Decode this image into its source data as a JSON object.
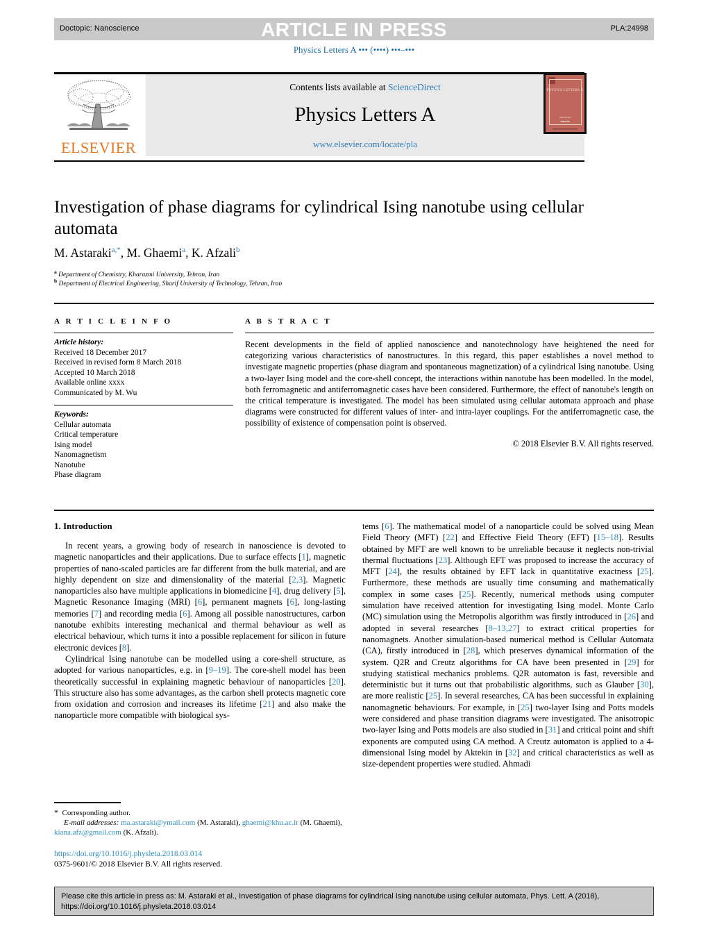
{
  "header": {
    "doctopic": "Doctopic: Nanoscience",
    "status_banner": "ARTICLE IN PRESS",
    "article_code": "PLA:24998",
    "running_head": "Physics Letters A ••• (••••) •••–•••"
  },
  "masthead": {
    "publisher_name": "ELSEVIER",
    "contents_prefix": "Contents lists available at ",
    "contents_link": "ScienceDirect",
    "journal_title": "Physics Letters A",
    "journal_url": "www.elsevier.com/locate/pla",
    "cover": {
      "title": "PHYSICS LETTERS A",
      "footer_small": "Editor-in-Chief",
      "footer_bold": "Editorial"
    }
  },
  "article": {
    "title": "Investigation of phase diagrams for cylindrical Ising nanotube using cellular automata",
    "authors_html": "M. Astaraki<sup>a,*</sup>, M. Ghaemi<sup>a</sup>, K. Afzali<sup>b</sup>",
    "authors_plain": "M. Astaraki a,*, M. Ghaemi a, K. Afzali b",
    "affiliations": [
      {
        "marker": "a",
        "text": "Department of Chemistry, Kharazmi University, Tehran, Iran"
      },
      {
        "marker": "b",
        "text": "Department of Electrical Engineering, Sharif University of Technology, Tehran, Iran"
      }
    ]
  },
  "article_info": {
    "heading": "A R T I C L E   I N F O",
    "history_label": "Article history:",
    "history": [
      "Received 18 December 2017",
      "Received in revised form 8 March 2018",
      "Accepted 10 March 2018",
      "Available online xxxx",
      "Communicated by M. Wu"
    ],
    "keywords_label": "Keywords:",
    "keywords": [
      "Cellular automata",
      "Critical temperature",
      "Ising model",
      "Nanomagnetism",
      "Nanotube",
      "Phase diagram"
    ]
  },
  "abstract": {
    "heading": "A B S T R A C T",
    "text": "Recent developments in the field of applied nanoscience and nanotechnology have heightened the need for categorizing various characteristics of nanostructures. In this regard, this paper establishes a novel method to investigate magnetic properties (phase diagram and spontaneous magnetization) of a cylindrical Ising nanotube. Using a two-layer Ising model and the core-shell concept, the interactions within nanotube has been modelled. In the model, both ferromagnetic and antiferromagnetic cases have been considered. Furthermore, the effect of nanotube's length on the critical temperature is investigated. The model has been simulated using cellular automata approach and phase diagrams were constructed for different values of inter- and intra-layer couplings. For the antiferromagnetic case, the possibility of existence of compensation point is observed.",
    "copyright": "© 2018 Elsevier B.V. All rights reserved."
  },
  "body": {
    "section_heading": "1. Introduction",
    "left_paragraph_1_html": "In recent years, a growing body of research in nanoscience is devoted to magnetic nanoparticles and their applications. Due to surface effects [<span class=\"cit\">1</span>], magnetic properties of nano-scaled particles are far different from the bulk material, and are highly dependent on size and dimensionality of the material [<span class=\"cit\">2,3</span>]. Magnetic nanoparticles also have multiple applications in biomedicine [<span class=\"cit\">4</span>], drug delivery [<span class=\"cit\">5</span>], Magnetic Resonance Imaging (MRI) [<span class=\"cit\">6</span>], permanent magnets [<span class=\"cit\">6</span>], long-lasting memories [<span class=\"cit\">7</span>] and recording media [<span class=\"cit\">6</span>]. Among all possible nanostructures, carbon nanotube exhibits interesting mechanical and thermal behaviour as well as electrical behaviour, which turns it into a possible replacement for silicon in future electronic devices [<span class=\"cit\">8</span>].",
    "left_paragraph_2_html": "Cylindrical Ising nanotube can be modelled using a core-shell structure, as adopted for various nanoparticles, e.g. in [<span class=\"cit\">9–19</span>]. The core-shell model has been theoretically successful in explaining magnetic behaviour of nanoparticles [<span class=\"cit\">20</span>]. This structure also has some advantages, as the carbon shell protects magnetic core from oxidation and corrosion and increases its lifetime [<span class=\"cit\">21</span>] and also make the nanoparticle more compatible with biological sys-",
    "right_paragraph_html": "tems [<span class=\"cit\">6</span>]. The mathematical model of a nanoparticle could be solved using Mean Field Theory (MFT) [<span class=\"cit\">22</span>] and Effective Field Theory (EFT) [<span class=\"cit\">15–18</span>]. Results obtained by MFT are well known to be unreliable because it neglects non-trivial thermal fluctuations [<span class=\"cit\">23</span>]. Although EFT was proposed to increase the accuracy of MFT [<span class=\"cit\">24</span>], the results obtained by EFT lack in quantitative exactness [<span class=\"cit\">25</span>]. Furthermore, these methods are usually time consuming and mathematically complex in some cases [<span class=\"cit\">25</span>]. Recently, numerical methods using computer simulation have received attention for investigating Ising model. Monte Carlo (MC) simulation using the Metropolis algorithm was firstly introduced in [<span class=\"cit\">26</span>] and adopted in several researches [<span class=\"cit\">8–13,27</span>] to extract critical properties for nanomagnets. Another simulation-based numerical method is Cellular Automata (CA), firstly introduced in [<span class=\"cit\">28</span>], which preserves dynamical information of the system. Q2R and Creutz algorithms for CA have been presented in [<span class=\"cit\">29</span>] for studying statistical mechanics problems. Q2R automaton is fast, reversible and deterministic but it turns out that probabilistic algorithms, such as Glauber [<span class=\"cit\">30</span>], are more realistic [<span class=\"cit\">25</span>]. In several researches, CA has been successful in explaining nanomagnetic behaviours. For example, in [<span class=\"cit\">25</span>] two-layer Ising and Potts models were considered and phase transition diagrams were investigated. The anisotropic two-layer Ising and Potts models are also studied in [<span class=\"cit\">31</span>] and critical point and shift exponents are computed using CA method. A Creutz automaton is applied to a 4-dimensional Ising model by Aktekin in [<span class=\"cit\">32</span>] and critical characteristics as well as size-dependent properties were studied. Ahmadi"
  },
  "footnote": {
    "corresponding_marker": "*",
    "corresponding_label": "Corresponding author.",
    "email_label": "E-mail addresses:",
    "emails_html": "<a class=\"lnk\" href=\"#\">ma.astaraki@ymail.com</a> (M. Astaraki), <a class=\"lnk\" href=\"#\">ghaemi@khu.ac.ir</a> (M. Ghaemi), <a class=\"lnk\" href=\"#\">kiana.afz@gmail.com</a> (K. Afzali).",
    "doi": "https://doi.org/10.1016/j.physleta.2018.03.014",
    "issn_line": "0375-9601/© 2018 Elsevier B.V. All rights reserved."
  },
  "cite_box": {
    "text": "Please cite this article in press as: M. Astaraki et al., Investigation of phase diagrams for cylindrical Ising nanotube using cellular automata, Phys. Lett. A (2018), https://doi.org/10.1016/j.physleta.2018.03.014"
  },
  "colors": {
    "link_blue": "#2e8fc0",
    "citation_blue": "#2e8fc0",
    "elsevier_orange": "#e87722",
    "band_gray": "#c9c9c9",
    "masthead_gray": "#e9e9e9",
    "cover_red": "#c0675d"
  }
}
